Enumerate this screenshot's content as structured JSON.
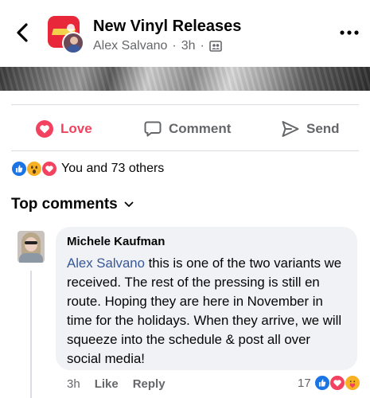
{
  "header": {
    "group_name": "New Vinyl Releases",
    "author": "Alex Salvano",
    "time": "3h",
    "separator": "·",
    "privacy_icon": "group-members-icon"
  },
  "actions": {
    "love_label": "Love",
    "comment_label": "Comment",
    "send_label": "Send"
  },
  "reactions": {
    "summary": "You and 73 others",
    "types": [
      "like",
      "wow",
      "love"
    ]
  },
  "top_comments_label": "Top comments",
  "comment": {
    "author": "Michele Kaufman",
    "mention": "Alex Salvano",
    "text": " this is one of the two variants we received. The rest of the pressing is still en route. Hoping they are here in November in time for the holidays. When they arrive, we will squeeze into the schedule & post all over social media!",
    "time": "3h",
    "like_label": "Like",
    "reply_label": "Reply",
    "reaction_count": "17",
    "reaction_types": [
      "like",
      "love",
      "care"
    ]
  },
  "colors": {
    "love_red": "#f3425f",
    "like_blue": "#1b74e4",
    "wow_yellow": "#f7b125",
    "mention_blue": "#385898",
    "secondary_text": "#65676b"
  }
}
